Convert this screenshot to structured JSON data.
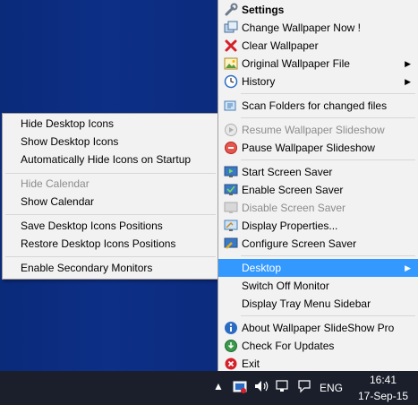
{
  "main_menu": {
    "settings": "Settings",
    "change_wallpaper": "Change Wallpaper Now !",
    "clear_wallpaper": "Clear Wallpaper",
    "original_wallpaper_file": "Original Wallpaper File",
    "history": "History",
    "scan_folders": "Scan Folders for changed files",
    "resume_slideshow": "Resume Wallpaper Slideshow",
    "pause_slideshow": "Pause Wallpaper Slideshow",
    "start_screen_saver": "Start Screen Saver",
    "enable_screen_saver": "Enable Screen Saver",
    "disable_screen_saver": "Disable Screen Saver",
    "display_properties": "Display Properties...",
    "configure_screen_saver": "Configure Screen Saver",
    "desktop": "Desktop",
    "switch_off_monitor": "Switch Off Monitor",
    "display_tray_menu_sidebar": "Display Tray Menu Sidebar",
    "about": "About Wallpaper SlideShow Pro",
    "check_updates": "Check For Updates",
    "exit": "Exit"
  },
  "desktop_submenu": {
    "hide_desktop_icons": "Hide Desktop Icons",
    "show_desktop_icons": "Show Desktop Icons",
    "auto_hide_icons": "Automatically Hide Icons on Startup",
    "hide_calendar": "Hide Calendar",
    "show_calendar": "Show Calendar",
    "save_icon_positions": "Save Desktop Icons Positions",
    "restore_icon_positions": "Restore Desktop Icons Positions",
    "enable_secondary_monitors": "Enable Secondary Monitors"
  },
  "taskbar": {
    "language": "ENG",
    "time": "16:41",
    "date": "17-Sep-15"
  },
  "colors": {
    "highlight": "#3399ff",
    "desktop": "#0d2f86",
    "taskbar": "#1a1f2b"
  }
}
